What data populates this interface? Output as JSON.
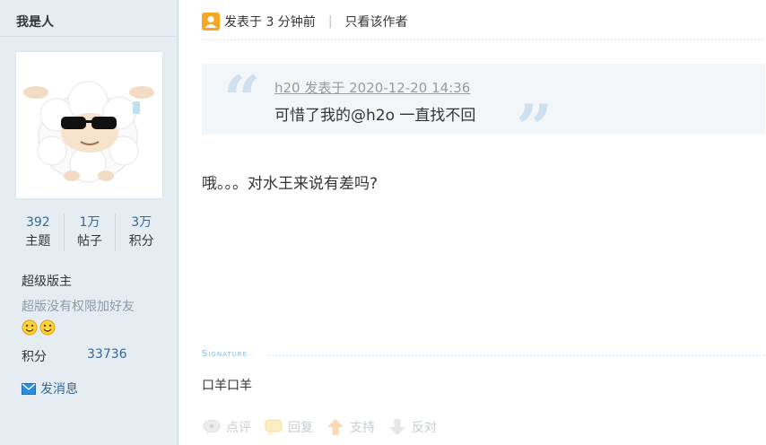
{
  "user": {
    "name": "我是人",
    "stats": [
      {
        "value": "392",
        "label": "主题"
      },
      {
        "value": "1万",
        "label": "帖子"
      },
      {
        "value": "3万",
        "label": "积分"
      }
    ],
    "role": "超级版主",
    "role_note": "超版没有权限加好友",
    "credit_label": "积分",
    "credit_value": "33736",
    "message_label": "发消息"
  },
  "post": {
    "posted_label": "发表于 3 分钟前",
    "only_author": "只看该作者",
    "quote": {
      "source": "h20 发表于 2020-12-20 14:36",
      "text": "可惜了我的@h2o 一直找不回"
    },
    "body": "哦。。。对水王来说有差吗?",
    "signature_label": "Signature",
    "signature": "口羊口羊",
    "actions": [
      {
        "label": "点评",
        "icon": "comment-icon"
      },
      {
        "label": "回复",
        "icon": "reply-icon"
      },
      {
        "label": "支持",
        "icon": "thumbs-up-arrow-icon"
      },
      {
        "label": "反对",
        "icon": "thumbs-down-arrow-icon"
      }
    ]
  },
  "colors": {
    "sidebar_bg": "#e5edf2",
    "link": "#336699",
    "accent_orange": "#f5a623"
  }
}
